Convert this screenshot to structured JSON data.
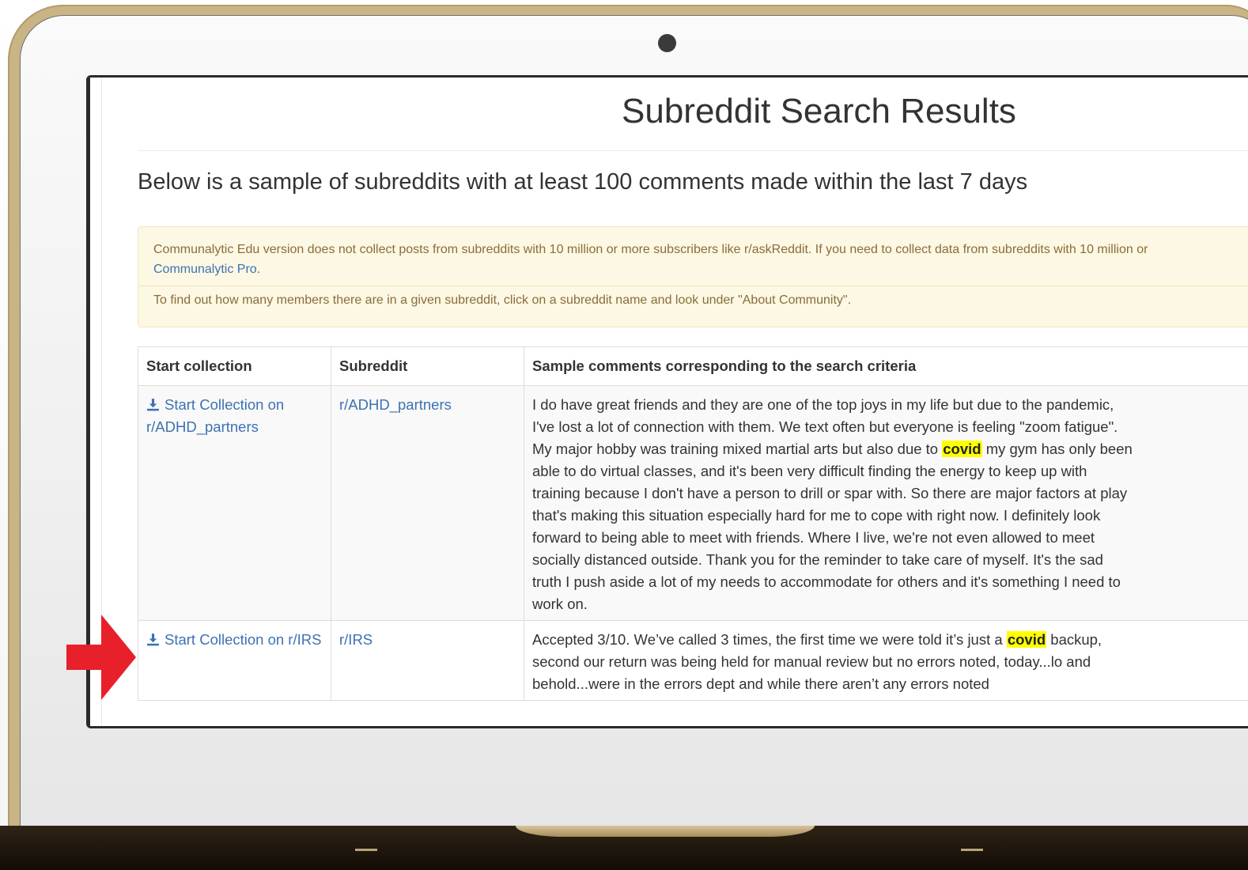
{
  "page": {
    "title": "Subreddit Search Results",
    "subtitle": "Below is a sample of subreddits with at least 100 comments made within the last 7 days"
  },
  "notice": {
    "line1": "Communalytic Edu version does not collect posts from subreddits with 10 million or more subscribers like r/askReddit. If you need to collect data from subreddits with 10 million or",
    "line1_link": "Communalytic Pro.",
    "line2": "To find out how many members there are in a given subreddit, click on a subreddit name and look under \"About Community\"."
  },
  "table": {
    "headers": {
      "start": "Start collection",
      "subreddit": "Subreddit",
      "comments": "Sample comments corresponding to the search criteria"
    },
    "rows": [
      {
        "start_label": "Start Collection on r/ADHD_partners",
        "subreddit": "r/ADHD_partners",
        "comment_before": "I do have great friends and they are one of the top joys in my life but due to the pandemic, I've lost a lot of connection with them. We text often but everyone is feeling \"zoom fatigue\". My major hobby was training mixed martial arts but also due to",
        "keyword": "covid",
        "comment_after": "my gym has only been able to do virtual classes, and it's been very difficult finding the energy to keep up with training because I don't have a person to drill or spar with. So there are major factors at play that's making this situation especially hard for me to cope with right now. I definitely look forward to being able to meet with friends. Where I live, we're not even allowed to meet socially distanced outside. Thank you for the reminder to take care of myself. It's the sad truth I push aside a lot of my needs to accommodate for others and it's something I need to work on."
      },
      {
        "start_label": "Start Collection on r/IRS",
        "subreddit": "r/IRS",
        "comment_before": "Accepted 3/10. We’ve called 3 times, the first time we were told it’s just a",
        "keyword": "covid",
        "comment_after": "backup, second our return was being held for manual review but no errors noted, today...lo and behold...were in the errors dept and while there aren’t any errors noted"
      }
    ]
  },
  "icons": {
    "download": "download-icon",
    "pointer": "red-arrow-icon"
  },
  "colors": {
    "link": "#3d72b3",
    "highlight": "#ffff00",
    "notice_bg": "#fcf8e3",
    "notice_text": "#8a6d3b",
    "arrow": "#e8202a",
    "laptop_frame": "#c9b486"
  }
}
